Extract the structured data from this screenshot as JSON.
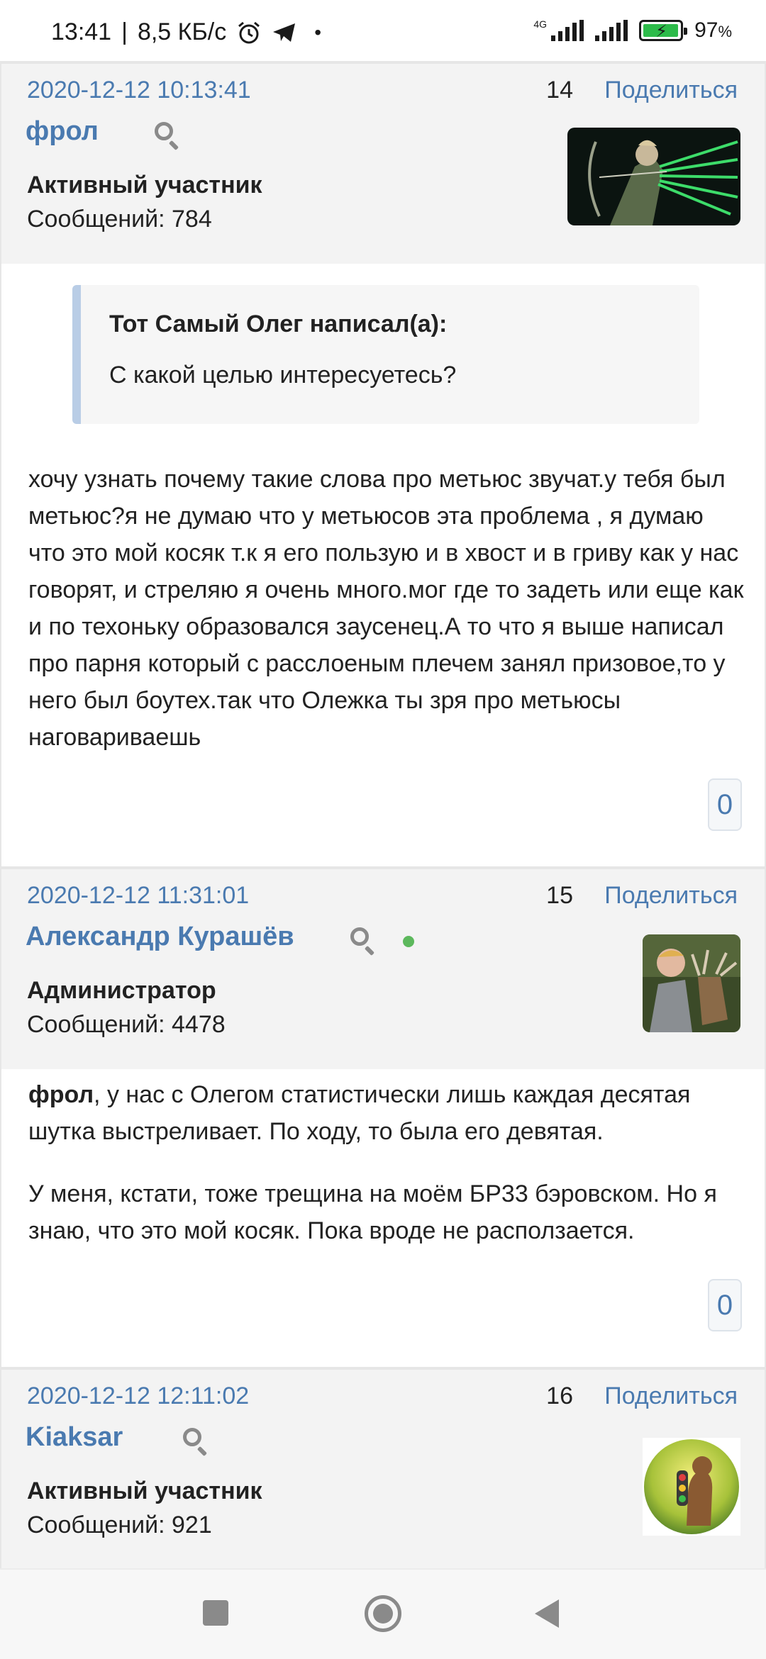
{
  "status_bar": {
    "time": "13:41",
    "separator": "|",
    "speed": "8,5 КБ/с",
    "network": "4G",
    "battery_percent": "97",
    "battery_unit": "%",
    "battery_level": 0.97,
    "icons": [
      "alarm-icon",
      "telegram-icon",
      "dot-icon",
      "signal-icon",
      "signal-icon",
      "battery-charging-icon"
    ]
  },
  "posts": [
    {
      "date": "2020-12-12 10:13:41",
      "number": "14",
      "share_label": "Поделиться",
      "author": "фрол",
      "role": "Активный участник",
      "messages": "Сообщений: 784",
      "quote": {
        "author": "Тот Самый Олег написал(а):",
        "text": "С какой целью интересуетесь?"
      },
      "text": "хочу узнать почему такие слова про метьюс  звучат.у тебя был метьюс?я не думаю что у метьюсов эта проблема , я думаю что это мой косяк т.к я его пользую и в хвост и в гриву как у нас говорят, и стреляю я очень много.мог где то задеть или еще как и по техоньку образовался заусенец.А то что я выше написал про парня который с расслоеным плечем занял призовое,то у него был боутех.так что Олежка ты зря про метьюсы наговариваешь",
      "reactions": "0"
    },
    {
      "date": "2020-12-12 11:31:01",
      "number": "15",
      "share_label": "Поделиться",
      "author": "Александр Курашёв",
      "role": "Администратор",
      "messages": "Сообщений: 4478",
      "mention": "фрол",
      "text_p1": ", у нас с Олегом статистически лишь каждая десятая шутка выстреливает. По ходу, то была его девятая.",
      "text_p2": "У меня, кстати, тоже трещина на моём БР33 бэровском. Но я знаю, что это мой косяк. Пока вроде не расползается.",
      "reactions": "0"
    },
    {
      "date": "2020-12-12 12:11:02",
      "number": "16",
      "share_label": "Поделиться",
      "author": "Kiaksar",
      "role": "Активный участник",
      "messages": "Сообщений: 921"
    }
  ],
  "colors": {
    "link": "#4a7ab0",
    "header_bg": "#f3f3f3",
    "quote_bar": "#b9cde6",
    "online": "#5cb85c"
  }
}
